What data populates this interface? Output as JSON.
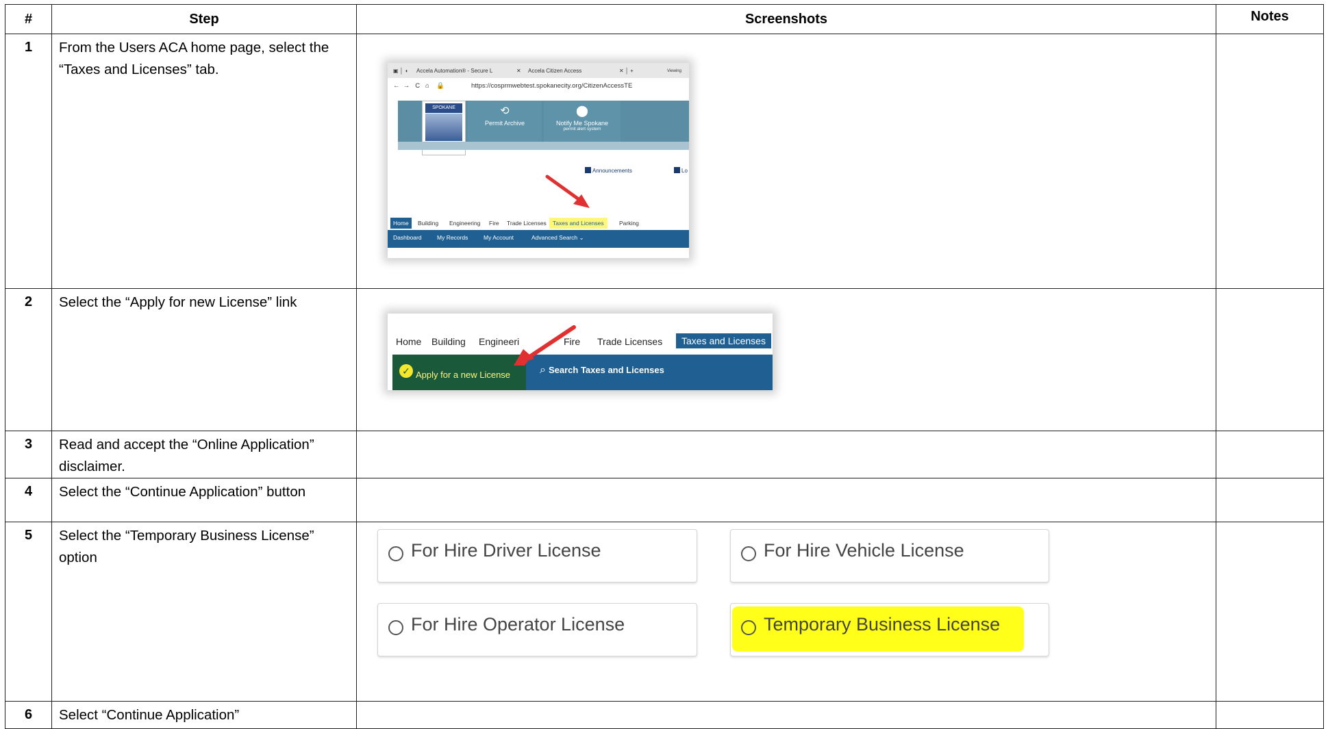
{
  "table": {
    "headers": {
      "num": "#",
      "step": "Step",
      "screenshots": "Screenshots",
      "notes": "Notes"
    }
  },
  "rows": [
    {
      "num": "1",
      "step": "From the Users ACA home page, select the “Taxes and Licenses” tab."
    },
    {
      "num": "2",
      "step": "Select the “Apply for new License” link"
    },
    {
      "num": "3",
      "step": "Read and accept the “Online Application” disclaimer."
    },
    {
      "num": "4",
      "step": "Select the “Continue Application” button"
    },
    {
      "num": "5",
      "step": "Select the “Temporary Business License” option"
    },
    {
      "num": "6",
      "step": "Select “Continue Application”"
    }
  ],
  "shot1": {
    "tab1": "Accela Automation® - Secure L",
    "tab2": "Accela Citizen Access",
    "tab_extra": "Viewing",
    "url": "https://cosprmwebtest.spokanecity.org/CitizenAccessTE",
    "logo_text": "SPOKANE",
    "tile1": "Permit Archive",
    "tile2": "Notify Me Spokane",
    "tile2_sub": "permit alert system",
    "announcements": "Announcements",
    "login": "Lo",
    "nav": [
      "Home",
      "Building",
      "Engineering",
      "Fire",
      "Trade Licenses",
      "Taxes and Licenses",
      "Parking"
    ],
    "subnav": [
      "Dashboard",
      "My Records",
      "My Account",
      "Advanced Search ⌄"
    ]
  },
  "shot2": {
    "nav": [
      "Home",
      "Building",
      "Engineeri",
      "Fire",
      "Trade Licenses",
      "Taxes and Licenses"
    ],
    "apply": "Apply for a new License",
    "search": "Search Taxes and Licenses"
  },
  "shot3": {
    "options": [
      "For Hire Driver License",
      "For Hire Vehicle License",
      "For Hire Operator License",
      "Temporary Business License"
    ]
  },
  "colors": {
    "nav_blue": "#1f5f92",
    "highlight": "#ffff1a",
    "arrow": "#e03030"
  }
}
